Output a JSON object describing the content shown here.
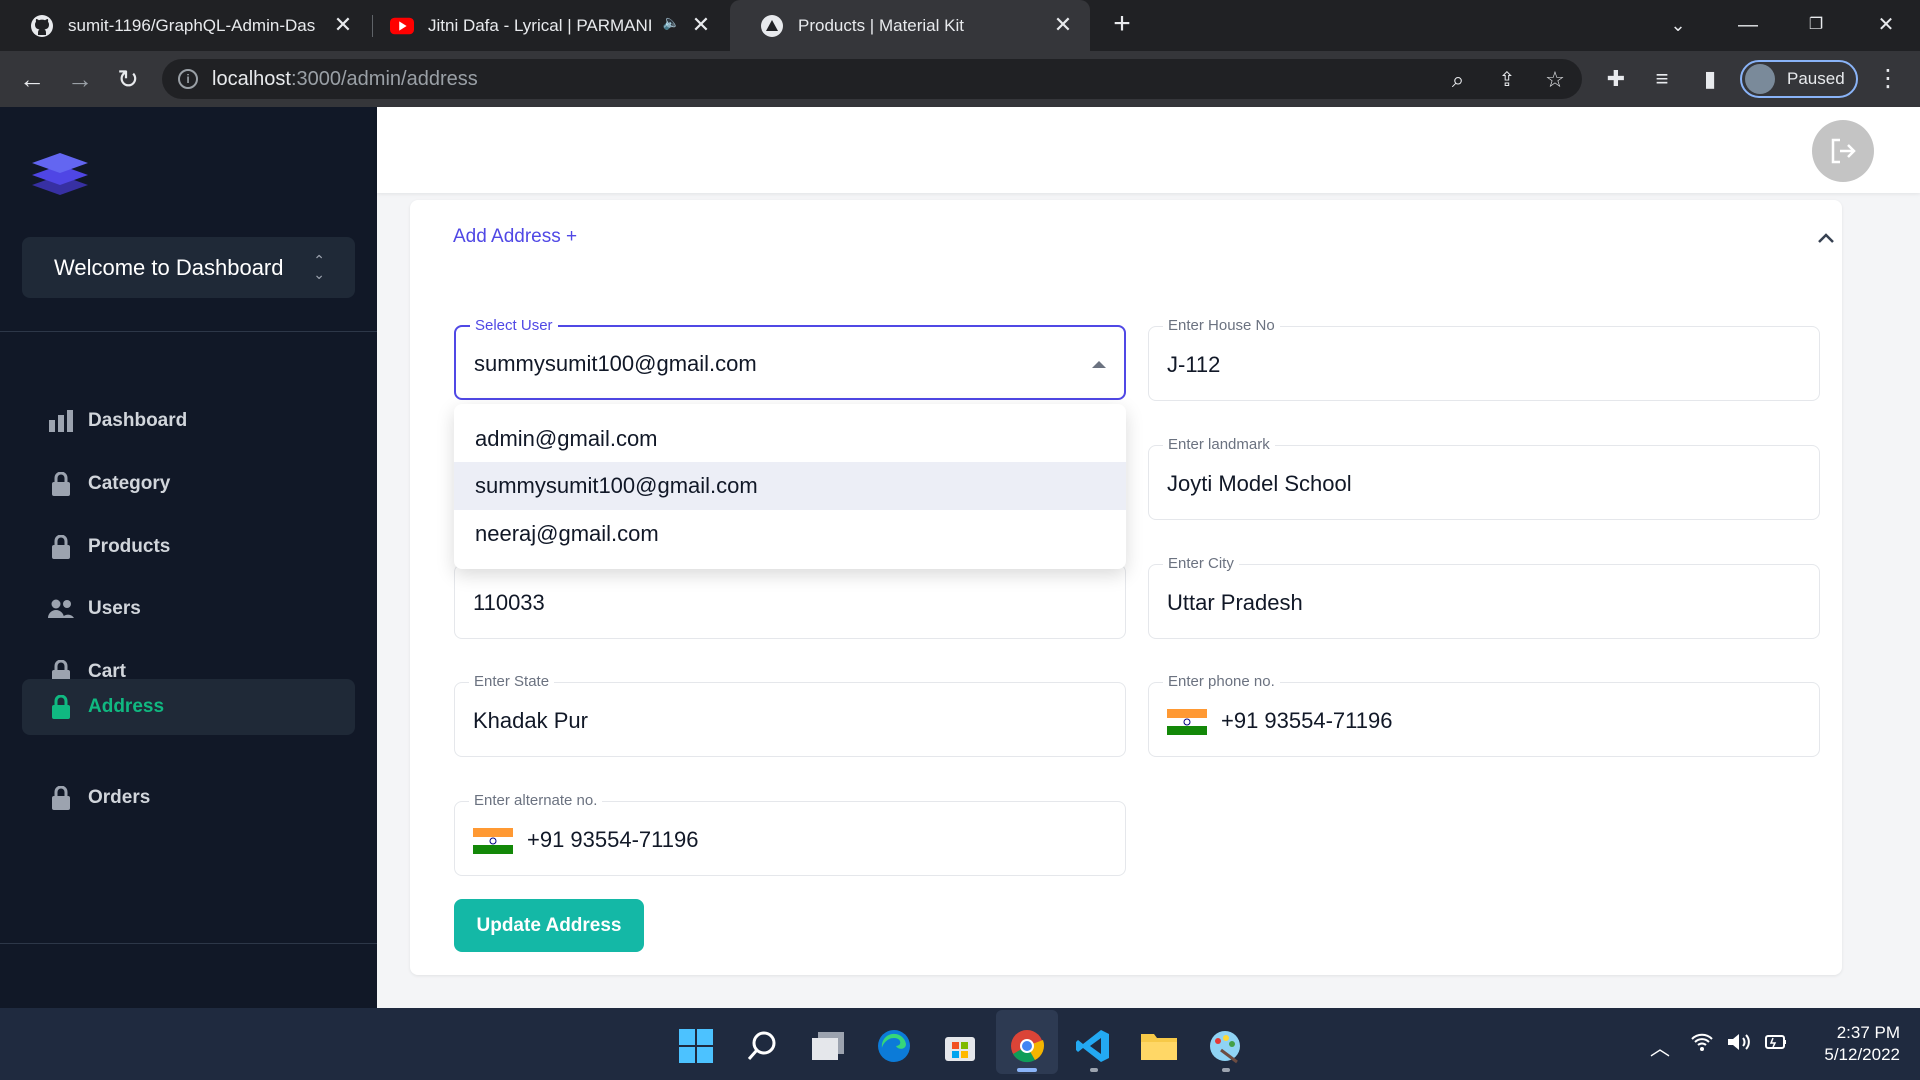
{
  "browser": {
    "tabs": [
      {
        "title": "sumit-1196/GraphQL-Admin-Das",
        "icon": "github-icon"
      },
      {
        "title": "Jitni Dafa - Lyrical | PARMANI",
        "icon": "youtube-icon"
      },
      {
        "title": "Products | Material Kit",
        "icon": "material-kit-icon"
      }
    ],
    "url_host": "localhost",
    "url_path": ":3000/admin/address",
    "profile_status": "Paused"
  },
  "sidebar": {
    "welcome": "Welcome to Dashboard",
    "items": [
      {
        "label": "Dashboard",
        "icon": "bar-chart-icon",
        "active": false
      },
      {
        "label": "Category",
        "icon": "lock-icon",
        "active": false
      },
      {
        "label": "Products",
        "icon": "lock-icon",
        "active": false
      },
      {
        "label": "Users",
        "icon": "users-icon",
        "active": false
      },
      {
        "label": "Cart",
        "icon": "lock-icon",
        "active": false
      },
      {
        "label": "Address",
        "icon": "lock-icon",
        "active": true
      },
      {
        "label": "Orders",
        "icon": "lock-icon",
        "active": false
      }
    ]
  },
  "form": {
    "header": "Add Address +",
    "select_user": {
      "label": "Select User",
      "value": "summysumit100@gmail.com"
    },
    "house_no": {
      "label": "Enter House No",
      "value": "J-112"
    },
    "landmark": {
      "label": "Enter landmark",
      "value": "Joyti Model School"
    },
    "pincode": {
      "value": "110033"
    },
    "city": {
      "label": "Enter City",
      "value": "Uttar Pradesh"
    },
    "state": {
      "label": "Enter State",
      "value": "Khadak Pur"
    },
    "phone": {
      "label": "Enter phone no.",
      "value": "+91 93554-71196"
    },
    "alternate": {
      "label": "Enter alternate no.",
      "value": "+91 93554-71196"
    },
    "submit": "Update Address"
  },
  "dropdown": {
    "options": [
      "admin@gmail.com",
      "summysumit100@gmail.com",
      "neeraj@gmail.com"
    ],
    "selected_index": 1
  },
  "taskbar": {
    "time": "2:37 PM",
    "date": "5/12/2022"
  },
  "colors": {
    "sidebar_bg": "#111827",
    "accent": "#5048e5",
    "active_nav": "#10b981",
    "button": "#14b8a6"
  }
}
